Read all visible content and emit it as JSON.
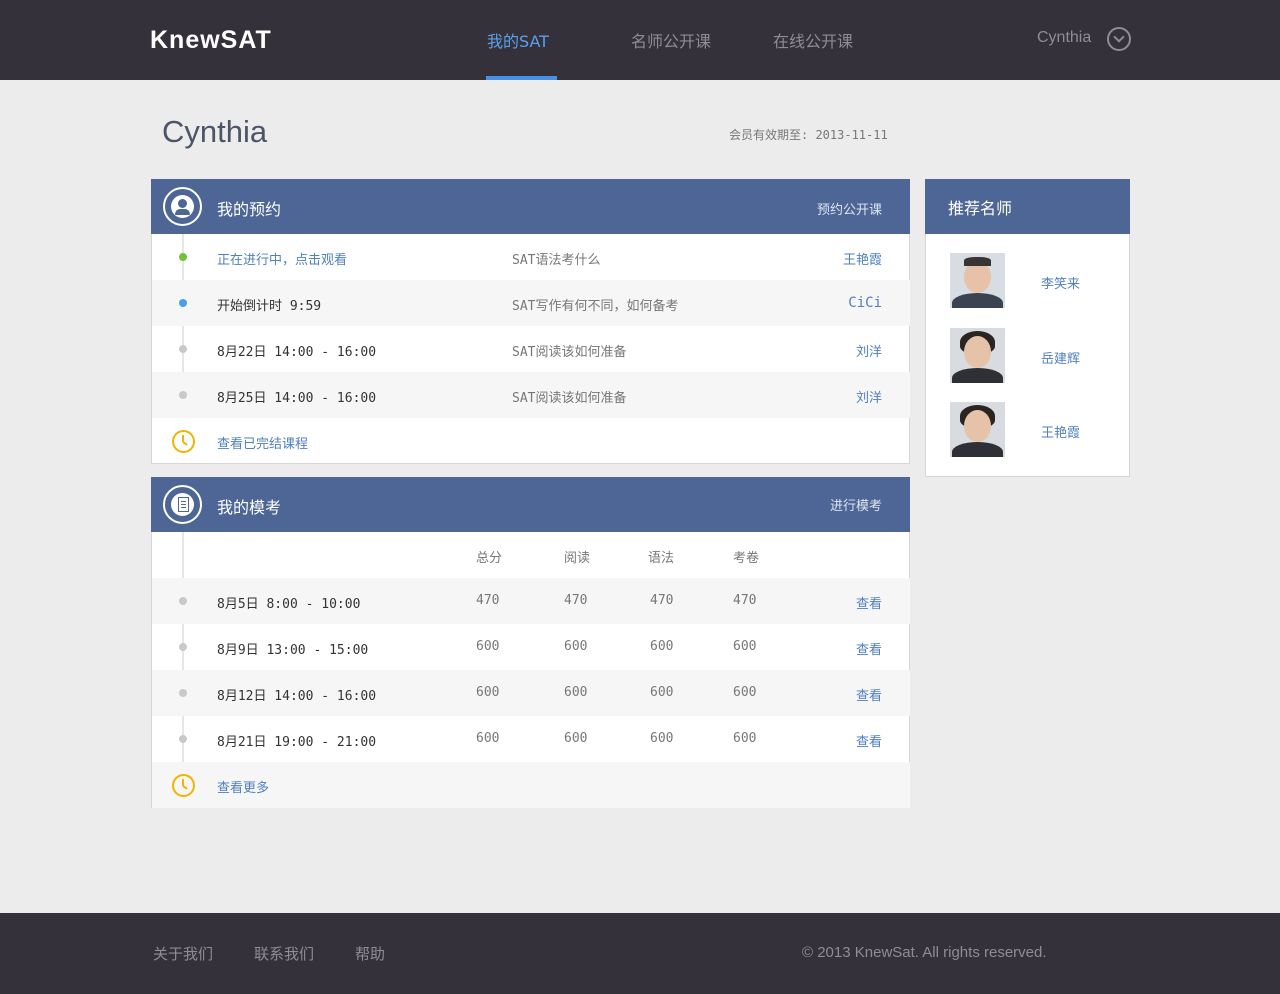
{
  "header": {
    "logo": "KnewSAT",
    "nav": [
      {
        "label": "我的SAT",
        "active": true
      },
      {
        "label": "名师公开课",
        "active": false
      },
      {
        "label": "在线公开课",
        "active": false
      }
    ],
    "user": "Cynthia",
    "user_menu_icon": "chevron-down-icon"
  },
  "profile": {
    "name": "Cynthia",
    "membership": "会员有效期至: 2013-11-11"
  },
  "appointments": {
    "title": "我的预约",
    "action": "预约公开课",
    "icon": "user-icon",
    "rows": [
      {
        "status": "green",
        "time": "正在进行中，点击观看",
        "course": "SAT语法考什么",
        "teacher": "王艳霞"
      },
      {
        "status": "blue",
        "time": "开始倒计时   9:59",
        "course": "SAT写作有何不同，如何备考",
        "teacher": "CiCi"
      },
      {
        "status": "gray",
        "time": "8月22日  14:00 - 16:00",
        "course": "SAT阅读该如何准备",
        "teacher": "刘洋"
      },
      {
        "status": "gray",
        "time": "8月25日  14:00 - 16:00",
        "course": "SAT阅读该如何准备",
        "teacher": "刘洋"
      }
    ],
    "footer_link": "查看已完结课程"
  },
  "mock_exams": {
    "title": "我的模考",
    "action": "进行模考",
    "icon": "document-icon",
    "columns": [
      "总分",
      "阅读",
      "语法",
      "考卷"
    ],
    "rows": [
      {
        "time": "8月5日   8:00 - 10:00",
        "total": "470",
        "reading": "470",
        "grammar": "470",
        "paper": "470",
        "view": "查看"
      },
      {
        "time": "8月9日   13:00 - 15:00",
        "total": "600",
        "reading": "600",
        "grammar": "600",
        "paper": "600",
        "view": "查看"
      },
      {
        "time": "8月12日   14:00 - 16:00",
        "total": "600",
        "reading": "600",
        "grammar": "600",
        "paper": "600",
        "view": "查看"
      },
      {
        "time": "8月21日   19:00 - 21:00",
        "total": "600",
        "reading": "600",
        "grammar": "600",
        "paper": "600",
        "view": "查看"
      }
    ],
    "footer_link": "查看更多"
  },
  "teachers": {
    "title": "推荐名师",
    "items": [
      {
        "name": "李笑来"
      },
      {
        "name": "岳建辉"
      },
      {
        "name": "王艳霞"
      }
    ]
  },
  "footer": {
    "links": [
      "关于我们",
      "联系我们",
      "帮助"
    ],
    "copyright": "© 2013 KnewSat. All rights reserved."
  },
  "colors": {
    "header_bg": "#34313b",
    "panel_head": "#4d6695",
    "accent": "#4a90e2",
    "link": "#4f7fbf",
    "status_live": "#6fc13a",
    "status_countdown": "#4a9fe8",
    "clock": "#f2b400"
  }
}
